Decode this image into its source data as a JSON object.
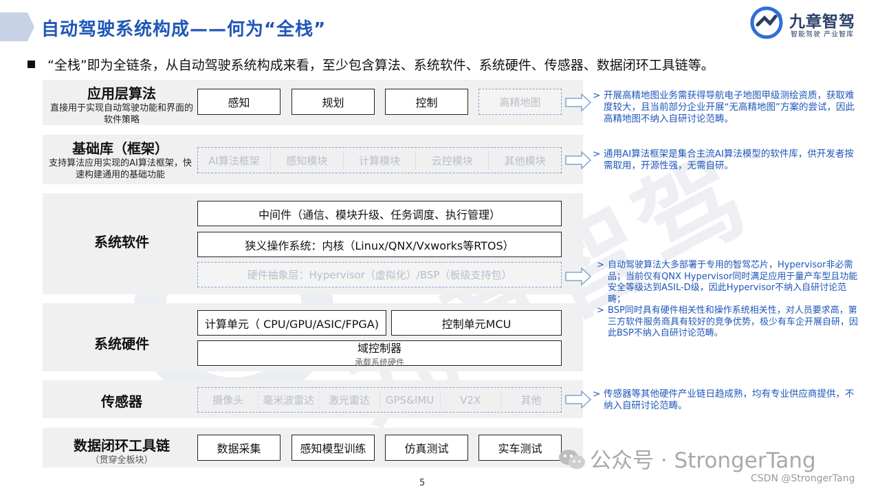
{
  "header": {
    "title": "自动驾驶系统构成——何为“全栈”",
    "logo_name": "九章智驾",
    "logo_sub": "智能驾驶 产业智库"
  },
  "bullet": "“全栈”即为全链条，从自动驾驶系统构成来看，至少包含算法、系统软件、系统硬件、传感器、数据闭环工具链等。",
  "layers": {
    "app": {
      "title": "应用层算法",
      "sub": "直接用于实现自动驾驶功能和界面的软件策略",
      "boxes": [
        "感知",
        "规划",
        "控制"
      ],
      "dashed": "高精地图",
      "note": "开展高精地图业务需获得导航电子地图甲级测绘资质，获取难度较大，且当前部分企业开展“无高精地图”方案的尝试，因此高精地图不纳入自研讨论范畴。"
    },
    "base": {
      "title": "基础库（框架）",
      "sub": "支持算法应用实现的AI算法框架，快速构建通用的基础功能",
      "dashed": [
        "AI算法框架",
        "感知模块",
        "计算模块",
        "云控模块",
        "其他模块"
      ],
      "note": "通用AI算法框架是集合主流AI算法模型的软件库，供开发者按需取用，开源性强，无需自研。"
    },
    "syssw": {
      "title": "系统软件",
      "middleware": "中间件（通信、模块升级、任务调度、执行管理）",
      "os": "狭义操作系统：内核（Linux/QNX/Vxworks等RTOS）",
      "hal": "硬件抽象层：Hypervisor（虚拟化）/BSP（板级支持包）",
      "notes": [
        "自动驾驶算法大多部署于专用的智驾芯片，Hypervisor非必需品；当前仅有QNX Hypervisor同时满足应用于量产车型且功能安全等级达到ASIL-D级，因此Hypervisor不纳入自研讨论范畴；",
        "BSP同时具有硬件相关性和操作系统相关性，对人员要求高，第三方软件服务商具有较好的竞争优势，极少有车企开展自研，因此BSP不纳入自研讨论范畴。"
      ]
    },
    "syshw": {
      "title": "系统硬件",
      "compute": "计算单元（ CPU/GPU/ASIC/FPGA)",
      "mcu": "控制单元MCU",
      "domain": "域控制器",
      "domain_sub": "承载系统硬件"
    },
    "sensor": {
      "title": "传感器",
      "dashed": [
        "摄像头",
        "毫米波雷达",
        "激光雷达",
        "GPS&IMU",
        "V2X",
        "其他"
      ],
      "note": "传感器等其他硬件产业链日趋成熟，均有专业供应商提供，不纳入自研讨论范畴。"
    },
    "data": {
      "title": "数据闭环工具链",
      "sub": "（贯穿全板块）",
      "boxes": [
        "数据采集",
        "感知模型训练",
        "仿真测试",
        "实车测试"
      ]
    }
  },
  "footer": {
    "page": "5",
    "wechat": "公众号 · StrongerTang",
    "csdn": "CSDN @StrongerTang"
  },
  "colors": {
    "title_blue": "#1f56b8",
    "band_gray": "#f0f0f0",
    "dash_blue": "#7fa3d6",
    "watermark": "#d7dbe2"
  }
}
